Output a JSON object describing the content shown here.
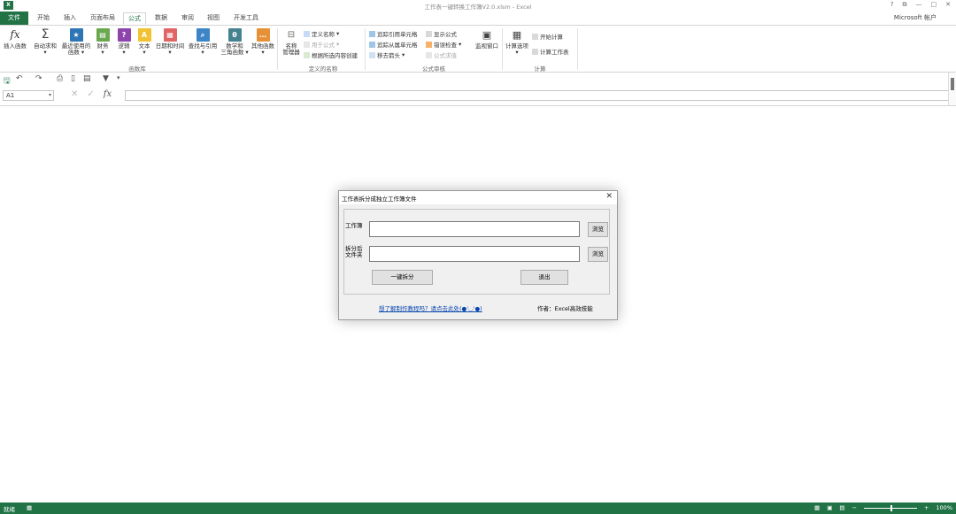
{
  "window": {
    "title": "工作表一键转换工作簿V2.0.xlsm - Excel",
    "account": "Microsoft 帐户",
    "logo": "X",
    "controls": {
      "help": "?",
      "restore": "⧉",
      "minimize": "—",
      "maximize": "□",
      "close": "✕"
    }
  },
  "tabs": {
    "file": "文件",
    "home": "开始",
    "insert": "插入",
    "layout": "页面布局",
    "formulas": "公式",
    "data": "数据",
    "review": "审阅",
    "view": "视图",
    "developer": "开发工具"
  },
  "ribbon": {
    "function_library": {
      "insert_function": "插入函数",
      "autosum": "自动求和",
      "recent_1": "最近使用的",
      "recent_2": "函数",
      "financial": "财务",
      "logical": "逻辑",
      "text": "文本",
      "datetime": "日期和时间",
      "lookup": "查找与引用",
      "math_1": "数学和",
      "math_2": "三角函数",
      "more": "其他函数",
      "group": "函数库"
    },
    "defined_names": {
      "name_manager_1": "名称",
      "name_manager_2": "管理器",
      "define_name": "定义名称",
      "use_in_formula": "用于公式",
      "create_from_selection": "根据所选内容创建",
      "group": "定义的名称"
    },
    "auditing": {
      "trace_precedents": "追踪引用单元格",
      "trace_dependents": "追踪从属单元格",
      "remove_arrows": "移去箭头",
      "show_formulas": "显示公式",
      "error_checking": "错误检查",
      "evaluate_formula": "公式求值",
      "watch_window": "监视窗口",
      "group": "公式审核"
    },
    "calculation": {
      "options": "计算选项",
      "calc_now": "开始计算",
      "calc_sheet": "计算工作表",
      "group": "计算"
    }
  },
  "formula_bar": {
    "name_box": "A1",
    "fx": "fx",
    "value": ""
  },
  "dialog": {
    "title": "工作表拆分成独立工作簿文件",
    "workbook_label": "工作簿",
    "workbook_value": "",
    "folder_label_1": "拆分后",
    "folder_label_2": "文件夹",
    "folder_value": "",
    "browse_1": "浏览",
    "browse_2": "浏览",
    "split_button": "一键拆分",
    "exit_button": "退出",
    "help_link": "想了解制作教程吗？请点击此处(●'◡'●)",
    "author": "作者：Excel高效技能"
  },
  "status_bar": {
    "ready": "就绪",
    "zoom": "100%"
  }
}
